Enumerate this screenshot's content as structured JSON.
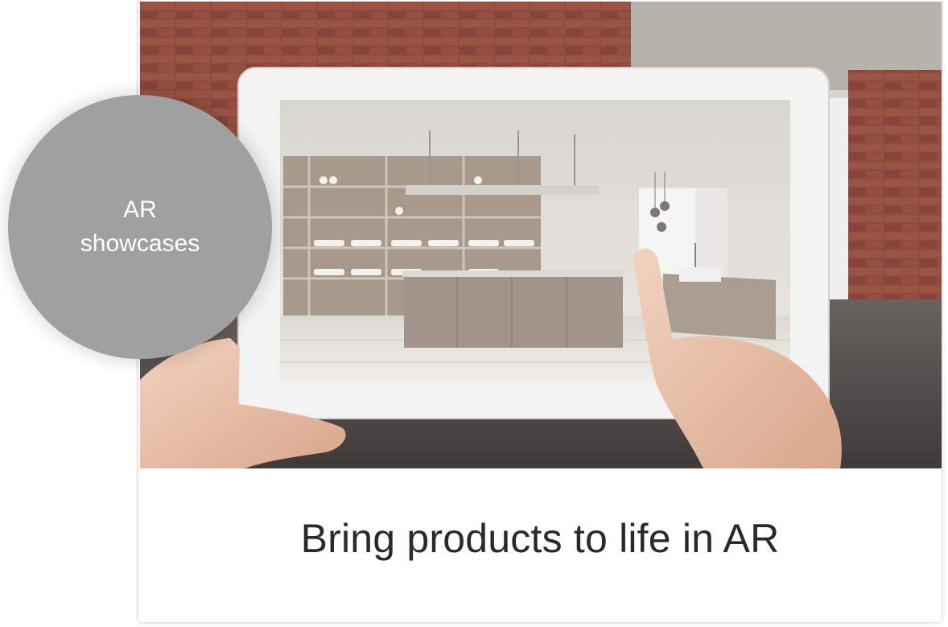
{
  "hero": {
    "image_name": "ar-kitchen-tablet-photo",
    "colors": {
      "brick": "#8e4a3c",
      "floor": "#5a5553",
      "tablet_frame": "#f3f3f3",
      "kitchen_wall": "#e6e2dd"
    }
  },
  "badge": {
    "line1": "AR",
    "line2": "showcases",
    "color": "#a0a0a0"
  },
  "caption": {
    "text": "Bring products to life in AR"
  }
}
